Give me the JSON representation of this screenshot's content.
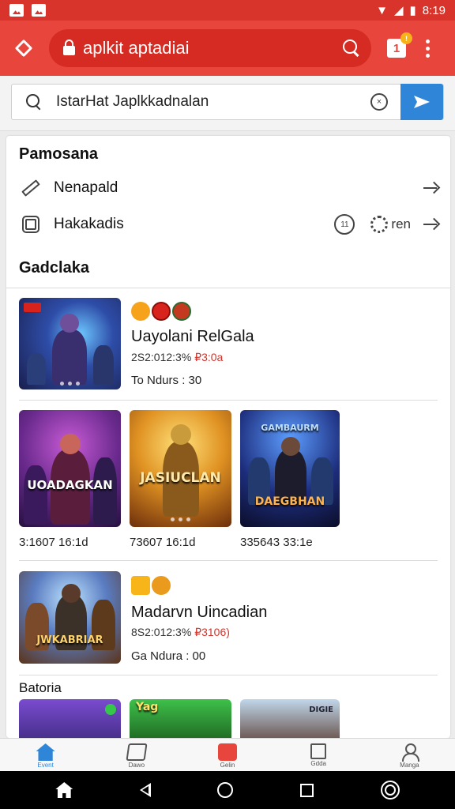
{
  "status_bar": {
    "time": "8:19"
  },
  "browser": {
    "url": "aplkit aptadiai",
    "tabs_count": "1",
    "tabs_badge": "!"
  },
  "search": {
    "query": "IstarHat Japlkkadnalan",
    "clear_glyph": "×"
  },
  "section1": {
    "title": "Pamosana",
    "items": [
      {
        "label": "Nenapald"
      },
      {
        "label": "Hakakadis",
        "circle_label": "11",
        "gear_label": "ren"
      }
    ]
  },
  "section2": {
    "title": "Gadclaka",
    "featured": [
      {
        "title": "Uayolani RelGala",
        "meta_gray": "2S2:012:3%",
        "meta_red": "₽3:0a",
        "sub": "To Ndurs : 30"
      },
      {
        "title": "Madarvn Uincadian",
        "meta_gray": "8S2:012:3%",
        "meta_red": "₽3106)",
        "sub": "Ga Ndura : 00"
      }
    ],
    "grid": [
      {
        "art": "UOADAGKAN",
        "caption": "3:1607 16:1d"
      },
      {
        "art": "JASIUCLAN",
        "caption": "73607 16:1d"
      },
      {
        "art": "DAEGBHAN",
        "art_top": "GAMBAURM",
        "caption": "335643 33:1e"
      }
    ],
    "featured2_art": "JWKABRIAR"
  },
  "section3": {
    "title": "Batoria",
    "grid": [
      {
        "art": ""
      },
      {
        "art": "Yag"
      },
      {
        "art": "DIGIE"
      }
    ]
  },
  "bottom_nav": [
    {
      "label": "Event",
      "icon": "home-icon"
    },
    {
      "label": "Dawo",
      "icon": "diary-icon"
    },
    {
      "label": "Gelin",
      "icon": "cart-icon"
    },
    {
      "label": "Gdda",
      "icon": "square-icon"
    },
    {
      "label": "Manga",
      "icon": "user-icon"
    }
  ],
  "colors": {
    "accent": "#e8453c",
    "blue": "#2f86d8",
    "status_bar": "#d9342b"
  }
}
